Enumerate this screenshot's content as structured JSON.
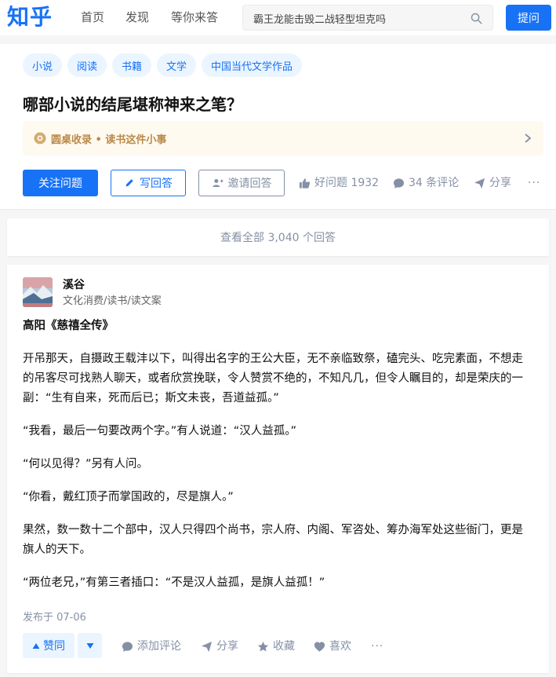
{
  "nav": {
    "logo": "知乎",
    "items": [
      "首页",
      "发现",
      "等你来答"
    ],
    "search_placeholder": "霸王龙能击毁二战轻型坦克吗",
    "ask_label": "提问"
  },
  "question": {
    "tags": [
      "小说",
      "阅读",
      "书籍",
      "文学",
      "中国当代文学作品"
    ],
    "title": "哪部小说的结尾堪称神来之笔？",
    "collection": "圆桌收录 • 读书这件小事",
    "follow_label": "关注问题",
    "write_label": "写回答",
    "invite_label": "邀请回答",
    "good_question_label": "好问题 1932",
    "comments_label": "34 条评论",
    "share_label": "分享",
    "more_label": "···"
  },
  "view_all_label": "查看全部 3,040 个回答",
  "answer": {
    "author": "溪谷",
    "bio": "文化消费/读书/读文案",
    "paragraphs": [
      "高阳《慈禧全传》",
      "开吊那天，自摄政王载沣以下，叫得出名字的王公大臣，无不亲临致祭，磕完头、吃完素面，不想走的吊客尽可找熟人聊天，或者欣赏挽联，令人赞赏不绝的，不知凡几，但令人瞩目的，却是荣庆的一副：“生有自来，死而后已；斯文未丧，吾道益孤。”",
      "“我看，最后一句要改两个字。”有人说道：“汉人益孤。”",
      "“何以见得？”另有人问。",
      "“你看，戴红顶子而掌国政的，尽是旗人。”",
      "果然，数一数十二个部中，汉人只得四个尚书，宗人府、内阁、军咨处、筹办海军处这些衙门，更是旗人的天下。",
      "“两位老兄，”有第三者插口：“不是汉人益孤，是旗人益孤！”"
    ],
    "published": "发布于 07-06",
    "upvote_label": "赞同",
    "comment_label": "添加评论",
    "share_label": "分享",
    "collect_label": "收藏",
    "like_label": "喜欢",
    "more_label": "···"
  },
  "colors": {
    "brand": "#1772f6",
    "muted": "#8590a6",
    "collection_text": "#b98a48"
  }
}
